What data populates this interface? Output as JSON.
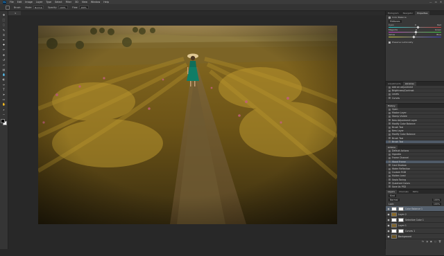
{
  "app": {
    "logo_text": "Ps"
  },
  "menu": [
    "File",
    "Edit",
    "Image",
    "Layer",
    "Type",
    "Select",
    "Filter",
    "3D",
    "View",
    "Window",
    "Help"
  ],
  "window_controls": {
    "minimize": "—",
    "maximize": "▭",
    "close": "✕"
  },
  "options_bar": {
    "brush_label": "Brush:",
    "mode_label": "Mode:",
    "mode_value": "Normal",
    "opacity_label": "Opacity:",
    "opacity_value": "100%",
    "flow_label": "Flow:",
    "flow_value": "100%"
  },
  "document_tab": {
    "title": "",
    "close": "×"
  },
  "tools": [
    {
      "name": "move-tool",
      "glyph": "✥"
    },
    {
      "name": "marquee-tool",
      "glyph": "⬚"
    },
    {
      "name": "lasso-tool",
      "glyph": "◌"
    },
    {
      "name": "quick-select-tool",
      "glyph": "✎"
    },
    {
      "name": "crop-tool",
      "glyph": "⌗"
    },
    {
      "name": "eyedropper-tool",
      "glyph": "✒"
    },
    {
      "name": "healing-tool",
      "glyph": "✚"
    },
    {
      "name": "brush-tool",
      "glyph": "✏"
    },
    {
      "name": "clone-stamp-tool",
      "glyph": "⎈"
    },
    {
      "name": "history-brush-tool",
      "glyph": "↺"
    },
    {
      "name": "eraser-tool",
      "glyph": "▱"
    },
    {
      "name": "gradient-tool",
      "glyph": "▤"
    },
    {
      "name": "blur-tool",
      "glyph": "💧"
    },
    {
      "name": "dodge-tool",
      "glyph": "◐"
    },
    {
      "name": "pen-tool",
      "glyph": "✑"
    },
    {
      "name": "type-tool",
      "glyph": "T"
    },
    {
      "name": "path-select-tool",
      "glyph": "➤"
    },
    {
      "name": "shape-tool",
      "glyph": "▭"
    },
    {
      "name": "hand-tool",
      "glyph": "✋"
    },
    {
      "name": "zoom-tool",
      "glyph": "⌕"
    },
    {
      "name": "more-tools",
      "glyph": "···"
    }
  ],
  "top_panel": {
    "tabs": [
      "Histogram",
      "Navigator",
      "Properties"
    ],
    "active_tab": 2,
    "header": "Color Balance",
    "tone_value": "Midtones",
    "sliders": [
      {
        "left": "Cyan",
        "right": "Red",
        "value": "0",
        "pos": 0.56,
        "color": "linear-gradient(90deg,#19d6d6,#d43a3a)"
      },
      {
        "left": "Magenta",
        "right": "Green",
        "value": "0",
        "pos": 0.52,
        "color": "linear-gradient(90deg,#d43ad4,#3ad43a)"
      },
      {
        "left": "Yellow",
        "right": "Blue",
        "value": "0",
        "pos": 0.48,
        "color": "linear-gradient(90deg,#d4d43a,#3a3ad4)"
      }
    ],
    "preserve_label": "Preserve Luminosity"
  },
  "adjust_panel": {
    "tabs": [
      "Adjustments",
      "Libraries"
    ],
    "active_tab": 1,
    "rows": [
      "Add an adjustment",
      "Brightness/Contrast",
      "Levels",
      "Curves"
    ]
  },
  "history_panel": {
    "tabs": [
      "History"
    ],
    "rows": [
      "Open",
      "Master Layer",
      "Stamp Visible",
      "New Adjustment Layer",
      "Modify Color Balance",
      "Brush Tool",
      "New Layer",
      "Modify Color Balance",
      "Brush Tool",
      "Brush Tool"
    ],
    "selected": 9
  },
  "actions_panel": {
    "tabs": [
      "Actions"
    ],
    "rows": [
      "Default Actions",
      "Vignette",
      "Frame Channel",
      "Wood Frame",
      "Cast Shadow",
      "Water Reflection",
      "Custom RGB",
      "Molten Lead",
      "Sepia Toning",
      "Quadrant Colors",
      "Save As PSD"
    ],
    "selected": 3
  },
  "layers_panel": {
    "tabs": [
      "Layers",
      "Channels",
      "Paths"
    ],
    "active_tab": 0,
    "kind_label": "Kind",
    "blend_mode": "Normal",
    "opacity": "100%",
    "fill": "100%",
    "lock_label": "Lock:",
    "layers": [
      {
        "name": "Color Balance 1",
        "has_mask": true,
        "thumb": "#ffffff",
        "selected": true
      },
      {
        "name": "Layer 2",
        "has_mask": false,
        "thumb": "#8a6a2a",
        "selected": false
      },
      {
        "name": "Selective Color 1",
        "has_mask": true,
        "thumb": "#ffffff",
        "selected": false
      },
      {
        "name": "Layer 1",
        "has_mask": false,
        "thumb": "#7e6530",
        "selected": false
      },
      {
        "name": "Curves 1",
        "has_mask": true,
        "thumb": "#ffffff",
        "selected": false
      },
      {
        "name": "Background",
        "has_mask": false,
        "thumb": "#6b5524",
        "selected": false
      }
    ],
    "bottom_icons": [
      "fx",
      "◑",
      "▣",
      "▢",
      "🗑"
    ]
  }
}
